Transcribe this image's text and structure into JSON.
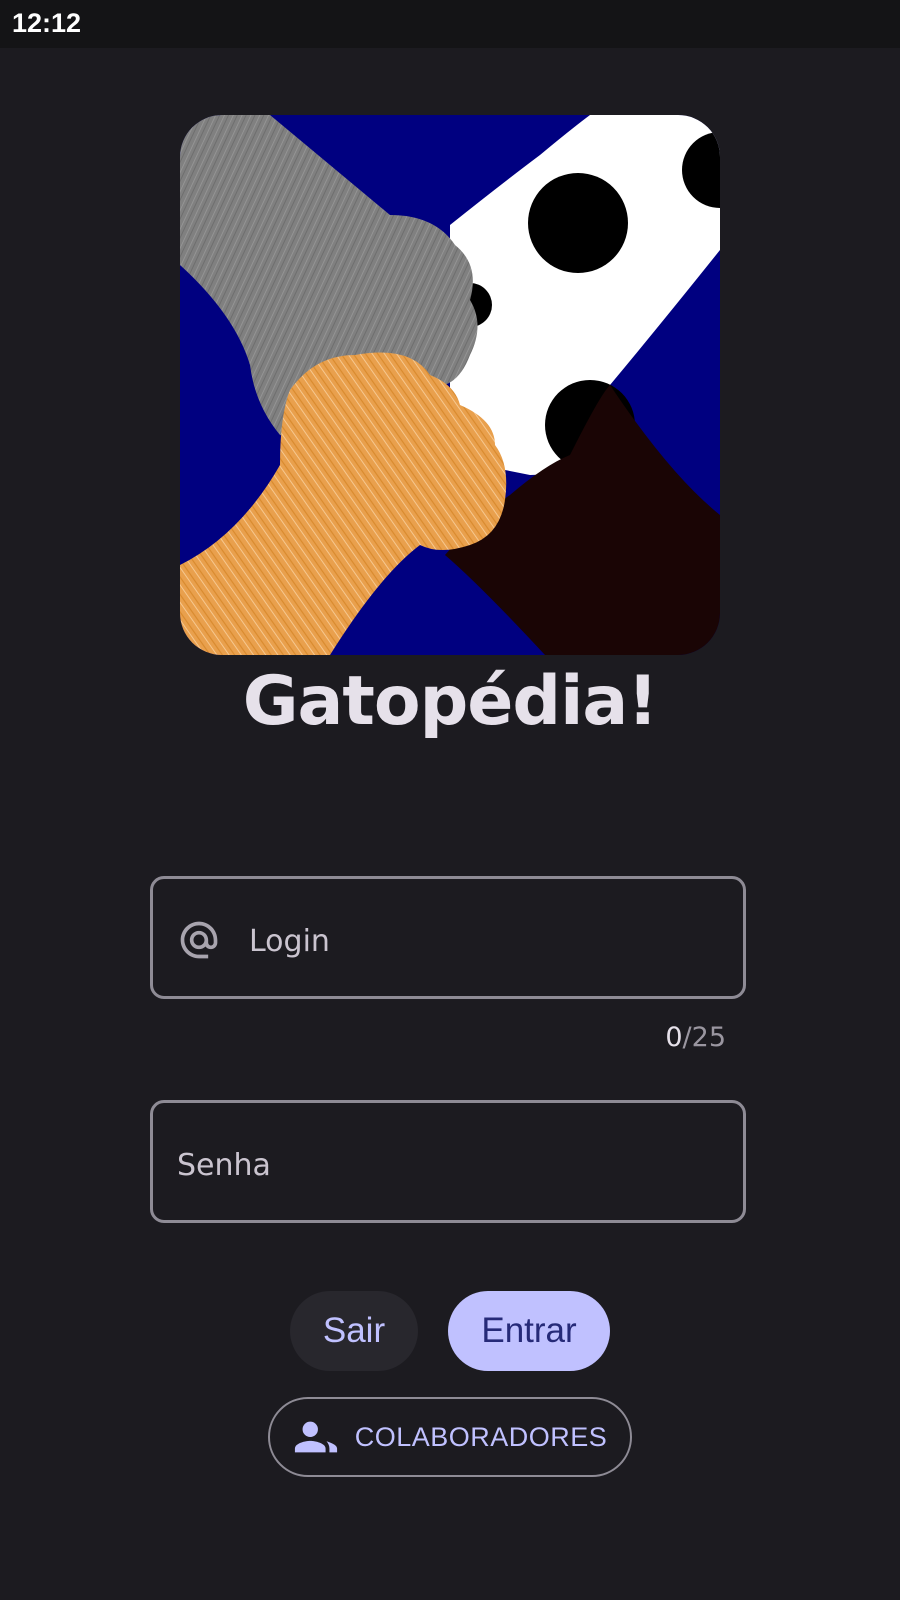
{
  "status_bar": {
    "time": "12:12"
  },
  "app": {
    "title": "Gatopédia!"
  },
  "logo": {
    "icon": "cat-paws-logo"
  },
  "login_field": {
    "placeholder": "Login",
    "icon": "at-icon",
    "char_count": "0",
    "char_max": "/25"
  },
  "password_field": {
    "placeholder": "Senha"
  },
  "buttons": {
    "exit_label": "Sair",
    "enter_label": "Entrar",
    "collaborators_label": "COLABORADORES",
    "collaborators_icon": "people-icon"
  },
  "colors": {
    "background": "#1c1b20",
    "primary": "#c0c1ff",
    "on_primary": "#262a78",
    "outline": "#8e8b95",
    "title": "#e6e1ea"
  }
}
